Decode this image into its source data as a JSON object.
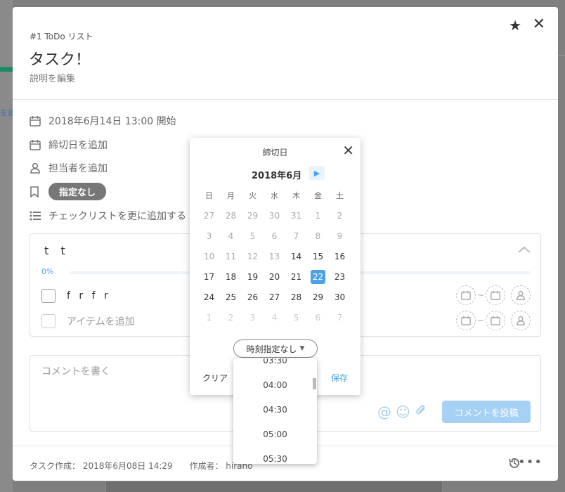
{
  "background": {
    "left_link": "を追"
  },
  "header": {
    "breadcrumb": "#1 ToDo リスト",
    "title": "タスク！",
    "description": "説明を編集"
  },
  "meta": {
    "start": "2018年6月14日 13:00 開始",
    "due": "締切日を追加",
    "assignee": "担当者を追加",
    "tag": "指定なし",
    "checklist_add": "チェックリストを更に追加する"
  },
  "checklist": {
    "title": "t t",
    "progress": "0%",
    "progress_fraction": 0,
    "items": [
      {
        "label": "f r f r"
      }
    ],
    "add_item": "アイテムを追加",
    "tilde": "~"
  },
  "comment": {
    "placeholder": "コメントを書く",
    "post": "コメントを投稿"
  },
  "footer": {
    "created": "タスク作成： 2018年6月08日 14:29",
    "author": "作成者： hirano"
  },
  "calendar": {
    "title": "締切日",
    "month": "2018年6月",
    "weekdays": [
      "日",
      "月",
      "火",
      "水",
      "木",
      "金",
      "土"
    ],
    "weeks": [
      [
        "27",
        "28",
        "29",
        "30",
        "31",
        "1",
        "2"
      ],
      [
        "3",
        "4",
        "5",
        "6",
        "7",
        "8",
        "9"
      ],
      [
        "10",
        "11",
        "12",
        "13",
        "14",
        "15",
        "16"
      ],
      [
        "17",
        "18",
        "19",
        "20",
        "21",
        "22",
        "23"
      ],
      [
        "24",
        "25",
        "26",
        "27",
        "28",
        "29",
        "30"
      ],
      [
        "1",
        "2",
        "3",
        "4",
        "5",
        "6",
        "7"
      ]
    ],
    "selected": "22",
    "time_select": "時刻指定なし",
    "clear": "クリア",
    "save": "保存"
  },
  "time_options": [
    "03:30",
    "04:00",
    "04:30",
    "05:00",
    "05:30"
  ],
  "icons": [
    "star-icon",
    "close-icon",
    "calendar-icon",
    "person-icon",
    "bookmark-icon",
    "list-icon",
    "chevron-up-icon",
    "at-icon",
    "smile-icon",
    "paperclip-icon",
    "history-icon",
    "more-icon",
    "arrow-right-icon"
  ],
  "colors": {
    "accent": "#4aa3e8",
    "tag_bg": "#777777",
    "post_button": "#a6d1f5"
  }
}
